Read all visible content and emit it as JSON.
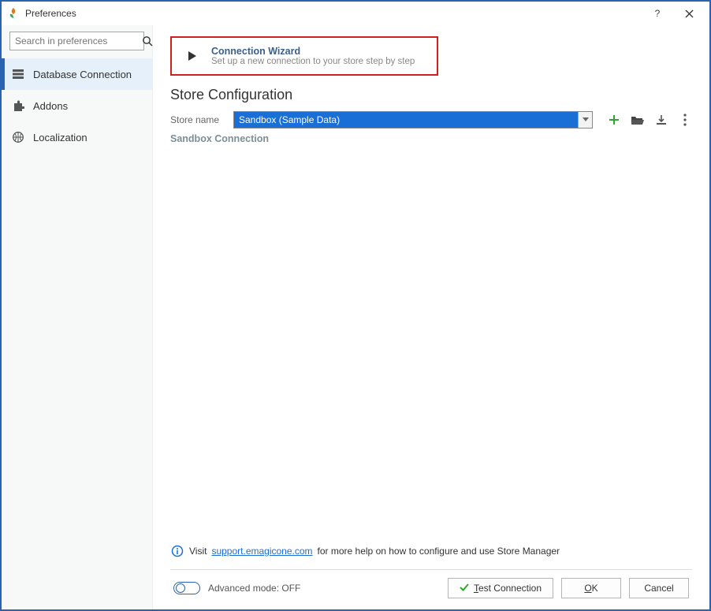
{
  "window": {
    "title": "Preferences"
  },
  "search": {
    "placeholder": "Search in preferences"
  },
  "sidebar": {
    "items": [
      {
        "label": "Database Connection"
      },
      {
        "label": "Addons"
      },
      {
        "label": "Localization"
      }
    ]
  },
  "wizard": {
    "title": "Connection Wizard",
    "subtitle": "Set up a new connection to your store step by step"
  },
  "section": {
    "title": "Store Configuration"
  },
  "store_name": {
    "label": "Store name",
    "value": "Sandbox (Sample Data)"
  },
  "connection_name": "Sandbox Connection",
  "footer": {
    "info_prefix": "Visit ",
    "info_link": "support.emagicone.com",
    "info_suffix": " for more help on how to configure and use Store Manager"
  },
  "bottom": {
    "advanced_label": "Advanced mode: OFF",
    "test_label": "Test Connection",
    "ok_label": "OK",
    "cancel_label": "Cancel"
  }
}
